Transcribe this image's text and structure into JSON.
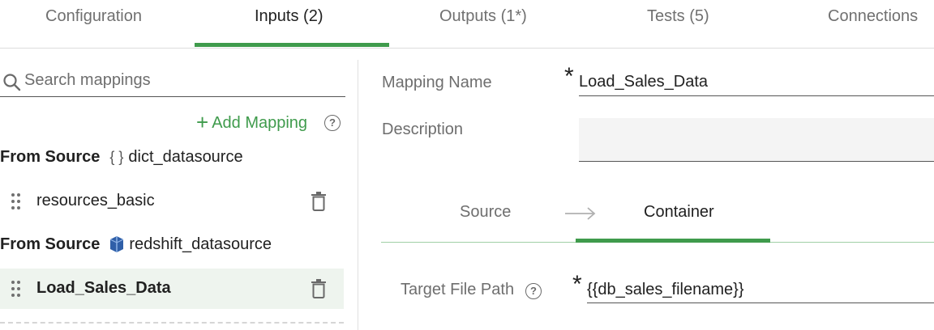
{
  "tabs": [
    {
      "label": "Configuration"
    },
    {
      "label": "Inputs (2)"
    },
    {
      "label": "Outputs (1*)"
    },
    {
      "label": "Tests (5)"
    },
    {
      "label": "Connections"
    }
  ],
  "active_tab": "Inputs (2)",
  "search": {
    "placeholder": "Search mappings",
    "value": ""
  },
  "add_mapping": {
    "label": "Add Mapping",
    "help": "?"
  },
  "sources": [
    {
      "label": "From Source",
      "icon_glyph": "{ }",
      "icon": "dict-icon",
      "name": "dict_datasource",
      "mappings": [
        {
          "label": "resources_basic",
          "selected": false
        }
      ]
    },
    {
      "label": "From Source",
      "icon": "redshift-icon",
      "name": "redshift_datasource",
      "mappings": [
        {
          "label": "Load_Sales_Data",
          "selected": true
        }
      ]
    }
  ],
  "form": {
    "mapping_name_label": "Mapping Name",
    "mapping_name_value": "Load_Sales_Data",
    "description_label": "Description",
    "description_value": "",
    "required_mark": "*",
    "subtabs": [
      {
        "label": "Source"
      },
      {
        "label": "Container"
      }
    ],
    "active_subtab": "Container",
    "target_file_path_label": "Target File Path",
    "target_file_path_value": "{{db_sales_filename}}",
    "help": "?"
  },
  "colors": {
    "accent": "#3f9b4c",
    "selected_row": "#eef4ee",
    "muted_text": "#6e6e6e"
  }
}
